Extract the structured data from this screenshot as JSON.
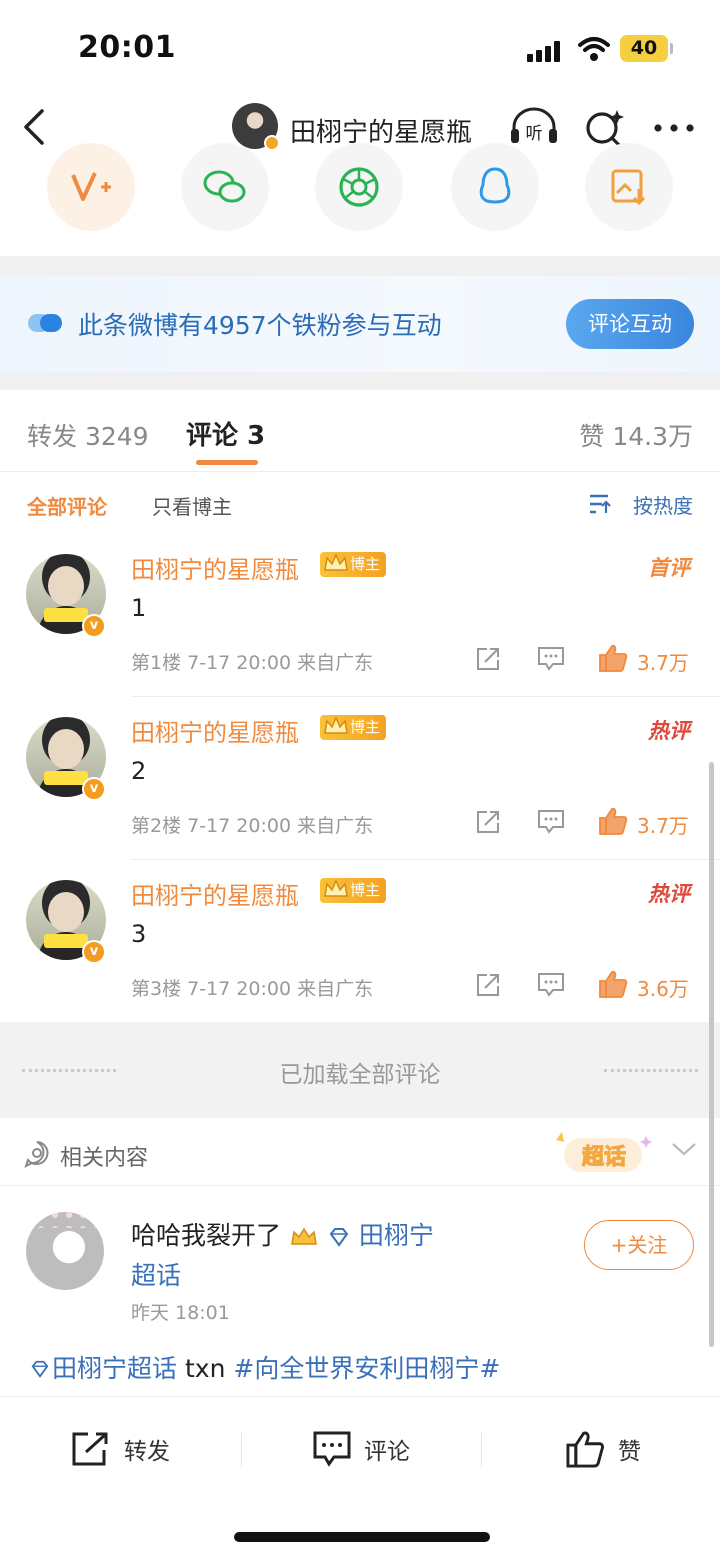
{
  "status_bar": {
    "time": "20:01",
    "battery": "40"
  },
  "nav": {
    "title": "田栩宁的星愿瓶",
    "listen_label": "听"
  },
  "share_icons": [
    "vplus-icon",
    "wechat-icon",
    "moments-icon",
    "qq-icon",
    "save-image-icon"
  ],
  "fans_banner": {
    "text": "此条微博有4957个铁粉参与互动",
    "button": "评论互动"
  },
  "tabs": {
    "repost": "转发 3249",
    "comments": "评论 3",
    "likes": "赞 14.3万"
  },
  "filters": {
    "all": "全部评论",
    "owner_only": "只看博主",
    "sort": "按热度"
  },
  "comments": [
    {
      "name": "田栩宁的星愿瓶",
      "badge": "博主",
      "tag": "首评",
      "tag_color": "#f08a3e",
      "text": "1",
      "meta": "第1楼 7-17 20:00 来自广东",
      "likes": "3.7万"
    },
    {
      "name": "田栩宁的星愿瓶",
      "badge": "博主",
      "tag": "热评",
      "tag_color": "#e2473c",
      "text": "2",
      "meta": "第2楼 7-17 20:00 来自广东",
      "likes": "3.7万"
    },
    {
      "name": "田栩宁的星愿瓶",
      "badge": "博主",
      "tag": "热评",
      "tag_color": "#e2473c",
      "text": "3",
      "meta": "第3楼 7-17 20:00 来自广东",
      "likes": "3.6万"
    }
  ],
  "loaded_text": "已加载全部评论",
  "related": {
    "title": "相关内容",
    "chaohua_label": "超话"
  },
  "post": {
    "text": "哈哈我裂开了",
    "topic": "田栩宁",
    "topic_suffix": "超话",
    "time": "昨天 18:01",
    "follow": "+关注",
    "tag1": "田栩宁超话",
    "tag_plain": "txn",
    "tag2": "#向全世界安利田栩宁#"
  },
  "bottom_bar": {
    "repost": "转发",
    "comment": "评论",
    "like": "赞"
  },
  "colors": {
    "accent": "#f08a3e",
    "link": "#3a70b8",
    "hot": "#e2473c"
  }
}
